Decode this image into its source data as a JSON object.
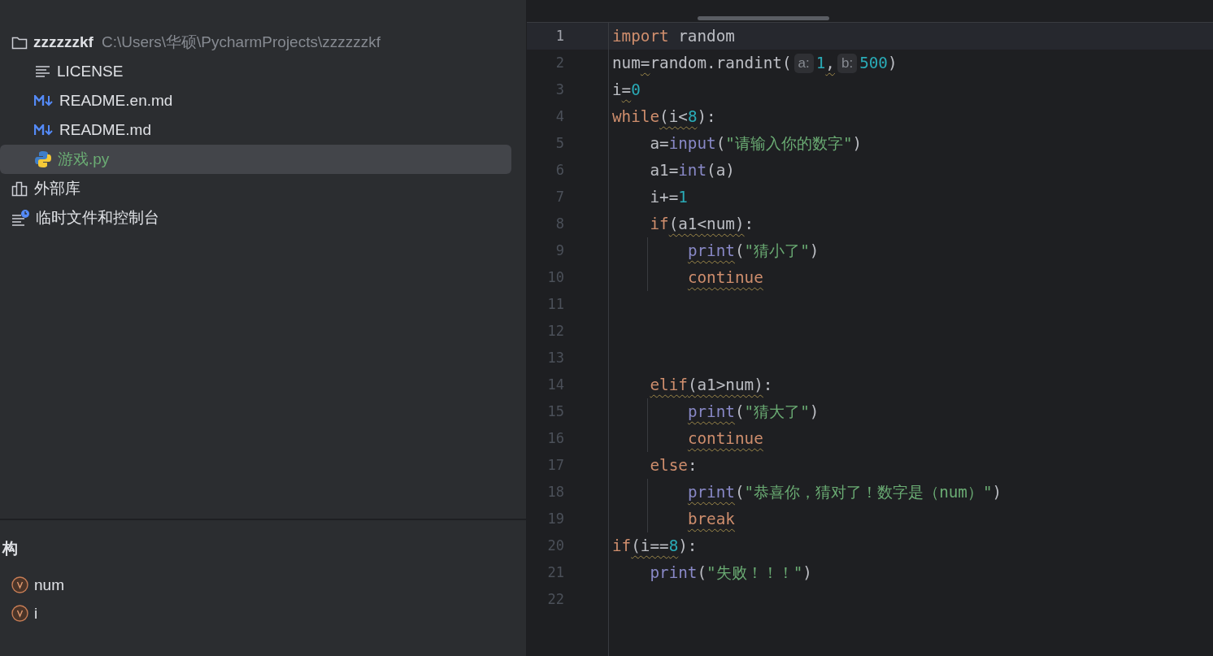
{
  "project_tree": {
    "root": {
      "name": "zzzzzzkf",
      "path": "C:\\Users\\华硕\\PycharmProjects\\zzzzzzkf",
      "children": [
        {
          "name": "LICENSE",
          "kind": "text",
          "selected": false
        },
        {
          "name": "README.en.md",
          "kind": "markdown",
          "selected": false
        },
        {
          "name": "README.md",
          "kind": "markdown",
          "selected": false
        },
        {
          "name": "游戏.py",
          "kind": "python",
          "selected": true
        }
      ]
    },
    "extra_items": [
      {
        "name": "外部库",
        "kind": "library"
      },
      {
        "name": "临时文件和控制台",
        "kind": "scratches"
      }
    ]
  },
  "structure": {
    "title": "构",
    "items": [
      {
        "name": "num"
      },
      {
        "name": "i"
      }
    ]
  },
  "editor": {
    "lines": [
      {
        "number": "1",
        "current": true,
        "tokens": [
          {
            "kind": "keyword",
            "text": "import"
          },
          {
            "kind": "plain",
            "text": " random"
          }
        ]
      },
      {
        "number": "2",
        "current": false,
        "tokens": [
          {
            "kind": "plain",
            "text": "num"
          },
          {
            "kind": "plain",
            "text": "=",
            "warn": true
          },
          {
            "kind": "plain",
            "text": "random.randint("
          },
          {
            "kind": "hint",
            "text": "a:"
          },
          {
            "kind": "number",
            "text": "1"
          },
          {
            "kind": "plain",
            "text": ",",
            "warn": true
          },
          {
            "kind": "hint",
            "text": "b:"
          },
          {
            "kind": "number",
            "text": "500"
          },
          {
            "kind": "plain",
            "text": ")"
          }
        ]
      },
      {
        "number": "3",
        "current": false,
        "tokens": [
          {
            "kind": "plain",
            "text": "i"
          },
          {
            "kind": "plain",
            "text": "=",
            "warn": true
          },
          {
            "kind": "number",
            "text": "0"
          }
        ]
      },
      {
        "number": "4",
        "current": false,
        "tokens": [
          {
            "kind": "keyword",
            "text": "while"
          },
          {
            "kind": "plain",
            "text": "(i<",
            "warn": true
          },
          {
            "kind": "number",
            "text": "8",
            "warn": true
          },
          {
            "kind": "plain",
            "text": "):"
          }
        ]
      },
      {
        "number": "5",
        "current": false,
        "tokens": [
          {
            "kind": "plain",
            "text": "    a="
          },
          {
            "kind": "builtin",
            "text": "input"
          },
          {
            "kind": "plain",
            "text": "("
          },
          {
            "kind": "string",
            "text": "\"请输入你的数字\""
          },
          {
            "kind": "plain",
            "text": ")"
          }
        ]
      },
      {
        "number": "6",
        "current": false,
        "tokens": [
          {
            "kind": "plain",
            "text": "    a1="
          },
          {
            "kind": "builtin",
            "text": "int"
          },
          {
            "kind": "plain",
            "text": "(a)"
          }
        ]
      },
      {
        "number": "7",
        "current": false,
        "tokens": [
          {
            "kind": "plain",
            "text": "    i+="
          },
          {
            "kind": "number",
            "text": "1"
          }
        ]
      },
      {
        "number": "8",
        "current": false,
        "tokens": [
          {
            "kind": "keyword",
            "text": "    if"
          },
          {
            "kind": "plain",
            "text": "(a1<num)",
            "warn": true
          },
          {
            "kind": "plain",
            "text": ":"
          }
        ]
      },
      {
        "number": "9",
        "current": false,
        "tokens": [
          {
            "kind": "builtin",
            "text": "        print",
            "warn": true
          },
          {
            "kind": "plain",
            "text": "("
          },
          {
            "kind": "string",
            "text": "\"猜小了\""
          },
          {
            "kind": "plain",
            "text": ")"
          }
        ]
      },
      {
        "number": "10",
        "current": false,
        "tokens": [
          {
            "kind": "keyword",
            "text": "        continue",
            "warn": true
          }
        ]
      },
      {
        "number": "11",
        "current": false
      },
      {
        "number": "12",
        "current": false
      },
      {
        "number": "13",
        "current": false
      },
      {
        "number": "14",
        "current": false,
        "tokens": [
          {
            "kind": "keyword",
            "text": "    elif",
            "warn": true
          },
          {
            "kind": "plain",
            "text": "(a1>num)",
            "warn": true
          },
          {
            "kind": "plain",
            "text": ":"
          }
        ]
      },
      {
        "number": "15",
        "current": false,
        "tokens": [
          {
            "kind": "builtin",
            "text": "        print",
            "warn": true
          },
          {
            "kind": "plain",
            "text": "("
          },
          {
            "kind": "string",
            "text": "\"猜大了\""
          },
          {
            "kind": "plain",
            "text": ")"
          }
        ]
      },
      {
        "number": "16",
        "current": false,
        "tokens": [
          {
            "kind": "keyword",
            "text": "        continue",
            "warn": true
          }
        ]
      },
      {
        "number": "17",
        "current": false,
        "tokens": [
          {
            "kind": "keyword",
            "text": "    else"
          },
          {
            "kind": "plain",
            "text": ":"
          }
        ]
      },
      {
        "number": "18",
        "current": false,
        "tokens": [
          {
            "kind": "builtin",
            "text": "        print",
            "warn": true
          },
          {
            "kind": "plain",
            "text": "("
          },
          {
            "kind": "string",
            "text": "\"恭喜你，猜对了！数字是（num）\""
          },
          {
            "kind": "plain",
            "text": ")"
          }
        ]
      },
      {
        "number": "19",
        "current": false,
        "tokens": [
          {
            "kind": "keyword",
            "text": "        break",
            "warn": true
          }
        ]
      },
      {
        "number": "20",
        "current": false,
        "tokens": [
          {
            "kind": "keyword",
            "text": "if"
          },
          {
            "kind": "plain",
            "text": "(i==",
            "warn": true
          },
          {
            "kind": "number",
            "text": "8",
            "warn": true
          },
          {
            "kind": "plain",
            "text": "):"
          }
        ]
      },
      {
        "number": "21",
        "current": false,
        "tokens": [
          {
            "kind": "builtin",
            "text": "    print"
          },
          {
            "kind": "plain",
            "text": "("
          },
          {
            "kind": "string",
            "text": "\"失败！！！\""
          },
          {
            "kind": "plain",
            "text": ")"
          }
        ]
      },
      {
        "number": "22",
        "current": false
      }
    ]
  }
}
